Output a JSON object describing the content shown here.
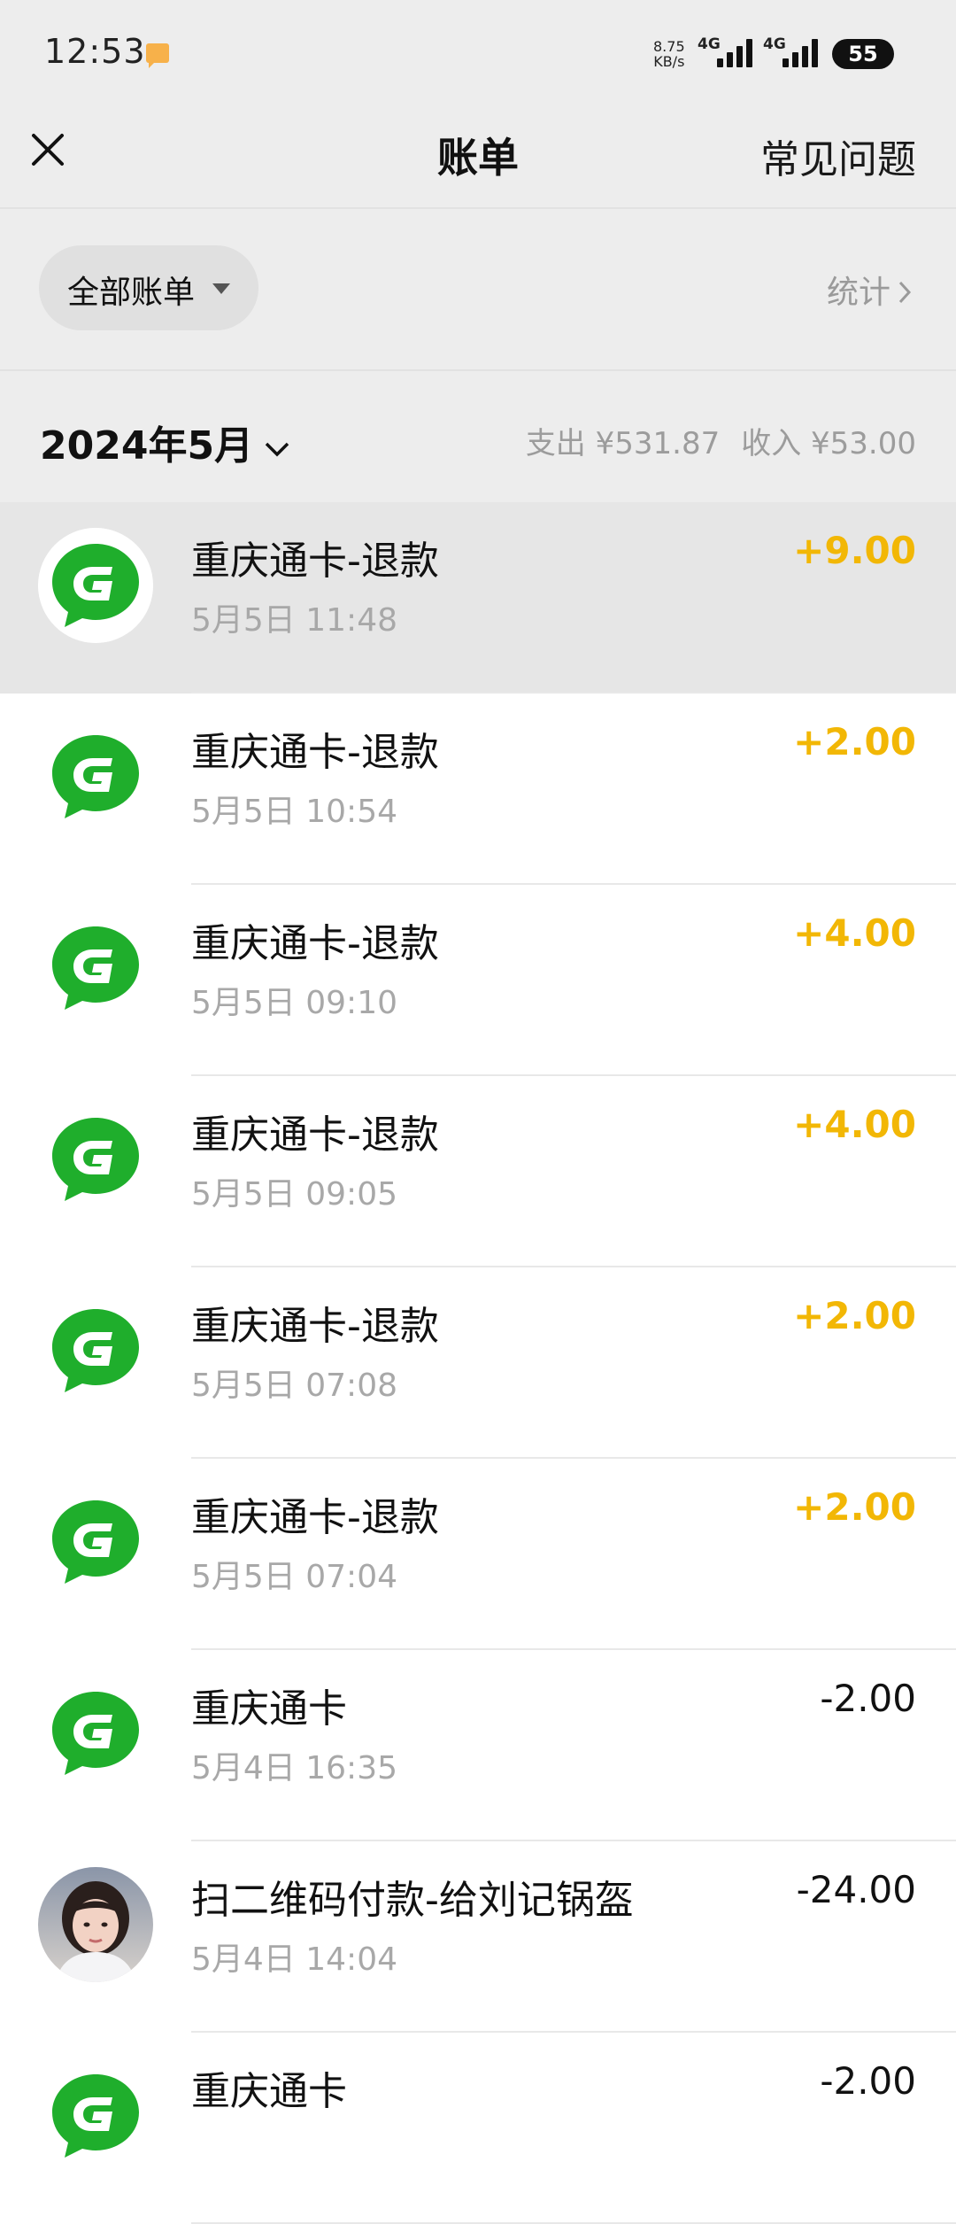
{
  "status_bar": {
    "time": "12:53",
    "net_speed_value": "8.75",
    "net_speed_unit": "KB/s",
    "network_1": "4G",
    "network_2": "4G",
    "battery": "55"
  },
  "nav": {
    "title": "账单",
    "faq": "常见问题"
  },
  "filter": {
    "label": "全部账单",
    "stats": "统计"
  },
  "month": {
    "label": "2024年5月",
    "expense": "支出 ¥531.87",
    "income": "收入 ¥53.00"
  },
  "transactions": [
    {
      "title": "重庆通卡-退款",
      "time": "5月5日 11:48",
      "amount": "+9.00",
      "type": "income",
      "icon": "green-g-logo-icon"
    },
    {
      "title": "重庆通卡-退款",
      "time": "5月5日 10:54",
      "amount": "+2.00",
      "type": "income",
      "icon": "green-g-logo-icon"
    },
    {
      "title": "重庆通卡-退款",
      "time": "5月5日 09:10",
      "amount": "+4.00",
      "type": "income",
      "icon": "green-g-logo-icon"
    },
    {
      "title": "重庆通卡-退款",
      "time": "5月5日 09:05",
      "amount": "+4.00",
      "type": "income",
      "icon": "green-g-logo-icon"
    },
    {
      "title": "重庆通卡-退款",
      "time": "5月5日 07:08",
      "amount": "+2.00",
      "type": "income",
      "icon": "green-g-logo-icon"
    },
    {
      "title": "重庆通卡-退款",
      "time": "5月5日 07:04",
      "amount": "+2.00",
      "type": "income",
      "icon": "green-g-logo-icon"
    },
    {
      "title": "重庆通卡",
      "time": "5月4日 16:35",
      "amount": "-2.00",
      "type": "expense",
      "icon": "green-g-logo-icon"
    },
    {
      "title": "扫二维码付款-给刘记锅盔",
      "time": "5月4日 14:04",
      "amount": "-24.00",
      "type": "expense",
      "icon": "user-photo-avatar"
    },
    {
      "title": "重庆通卡",
      "time": "",
      "amount": "-2.00",
      "type": "expense",
      "icon": "green-g-logo-icon"
    }
  ],
  "colors": {
    "income": "#f2b705",
    "brand_green": "#1fae2c",
    "background": "#ededed"
  }
}
